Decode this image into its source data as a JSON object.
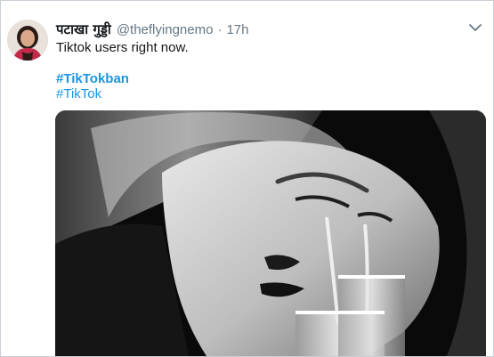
{
  "tweet": {
    "display_name": "पटाखा गुड्डी",
    "handle": "@theflyingnemo",
    "separator": "·",
    "timestamp": "17h",
    "text": "Tiktok users right now.",
    "hashtags": [
      "#TikTokban",
      "#TikTok"
    ],
    "menu_icon": "chevron-down-icon"
  },
  "colors": {
    "link": "#1b95e0",
    "meta": "#657786",
    "text": "#14171a"
  }
}
